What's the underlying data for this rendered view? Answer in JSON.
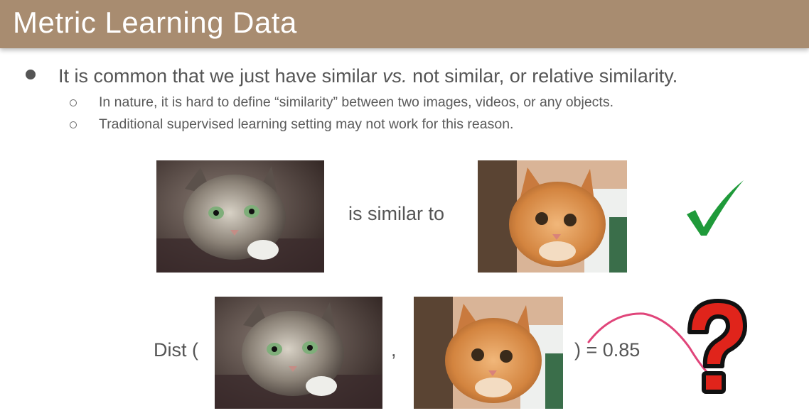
{
  "slide": {
    "title": "Metric Learning Data",
    "bullet1_pre": "It is common that we just have similar ",
    "bullet1_em": "vs.",
    "bullet1_post": " not similar, or relative similarity.",
    "sub_bullets": [
      "In nature, it is hard to define “similarity” between two images, videos, or any objects.",
      "Traditional supervised learning setting may not work for this reason."
    ],
    "similar_text": "is similar to",
    "dist_label": "Dist (",
    "comma": ",",
    "dist_value": ") = 0.85",
    "colors": {
      "title_bar": "#a88c70",
      "check": "#1f9a3a",
      "question": "#e0241b",
      "pen": "#e0457a"
    }
  }
}
